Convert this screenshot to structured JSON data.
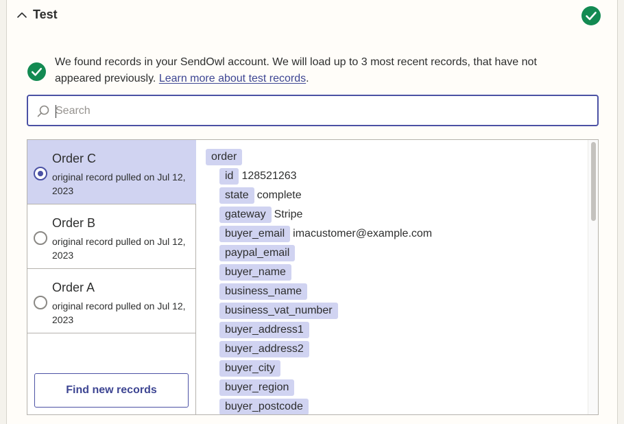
{
  "section": {
    "title": "Test"
  },
  "info": {
    "text": "We found records in your SendOwl account. We will load up to 3 most recent records, that have not appeared previously.",
    "link": "Learn more about test records",
    "after_link": "."
  },
  "search": {
    "placeholder": "Search",
    "value": ""
  },
  "records": [
    {
      "name": "Order C",
      "sub": "original record pulled on Jul 12, 2023",
      "selected": true
    },
    {
      "name": "Order B",
      "sub": "original record pulled on Jul 12, 2023",
      "selected": false
    },
    {
      "name": "Order A",
      "sub": "original record pulled on Jul 12, 2023",
      "selected": false
    }
  ],
  "find_button": "Find new records",
  "fields": {
    "root": "order",
    "items": [
      {
        "key": "id",
        "value": "128521263"
      },
      {
        "key": "state",
        "value": "complete"
      },
      {
        "key": "gateway",
        "value": "Stripe"
      },
      {
        "key": "buyer_email",
        "value": "imacustomer@example.com"
      },
      {
        "key": "paypal_email",
        "value": ""
      },
      {
        "key": "buyer_name",
        "value": ""
      },
      {
        "key": "business_name",
        "value": ""
      },
      {
        "key": "business_vat_number",
        "value": ""
      },
      {
        "key": "buyer_address1",
        "value": ""
      },
      {
        "key": "buyer_address2",
        "value": ""
      },
      {
        "key": "buyer_city",
        "value": ""
      },
      {
        "key": "buyer_region",
        "value": ""
      },
      {
        "key": "buyer_postcode",
        "value": ""
      }
    ]
  },
  "colors": {
    "accent": "#4b51a4",
    "success": "#138a52",
    "selected_bg": "#d0d3f1"
  },
  "icons": {
    "collapse": "chevron-up-icon",
    "status": "check-circle-icon",
    "search": "search-icon"
  }
}
